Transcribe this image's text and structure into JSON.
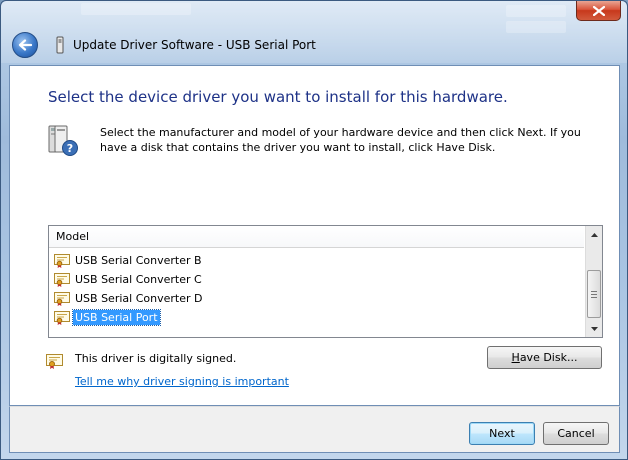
{
  "window": {
    "title": "Update Driver Software - USB Serial Port"
  },
  "header": {
    "heading": "Select the device driver you want to install for this hardware.",
    "instruction": "Select the manufacturer and model of your hardware device and then click Next. If you have a disk that contains the driver you want to install, click Have Disk."
  },
  "model_list": {
    "column_header": "Model",
    "items": [
      {
        "label": "USB Serial Converter B",
        "selected": false
      },
      {
        "label": "USB Serial Converter C",
        "selected": false
      },
      {
        "label": "USB Serial Converter D",
        "selected": false
      },
      {
        "label": "USB Serial Port",
        "selected": true
      }
    ]
  },
  "signing": {
    "status": "This driver is digitally signed.",
    "link": "Tell me why driver signing is important"
  },
  "buttons": {
    "have_disk_prefix": "H",
    "have_disk_rest": "ave Disk...",
    "next": "Next",
    "cancel": "Cancel"
  },
  "colors": {
    "heading": "#1e3287",
    "link": "#0066cc",
    "selection": "#3399ff"
  },
  "icons": {
    "back": "back-arrow-icon",
    "title": "usb-device-icon",
    "hardware": "hardware-help-icon",
    "certificate": "certificate-icon",
    "close": "close-icon"
  }
}
